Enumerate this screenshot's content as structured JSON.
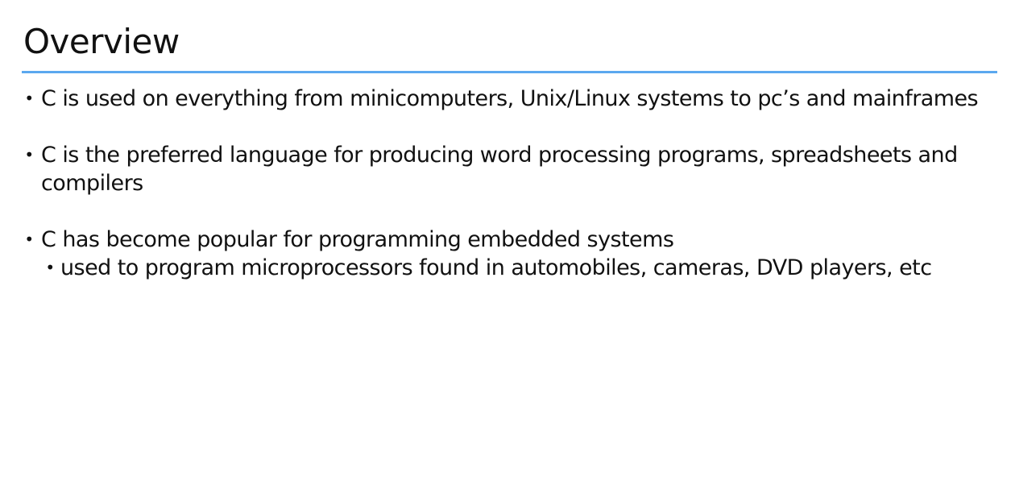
{
  "slide": {
    "title": "Overview",
    "accent_color": "#5ba8ef",
    "bullets": [
      {
        "text": "C is used on everything from minicomputers, Unix/Linux systems to pc’s and mainframes"
      },
      {
        "text": "C is the preferred language for producing word processing programs, spreadsheets and compilers"
      },
      {
        "text": "C has become popular for programming embedded systems",
        "sub_bullets": [
          "used to program microprocessors found in automobiles, cameras, DVD players, etc"
        ]
      }
    ],
    "bullet_symbol": "•"
  }
}
